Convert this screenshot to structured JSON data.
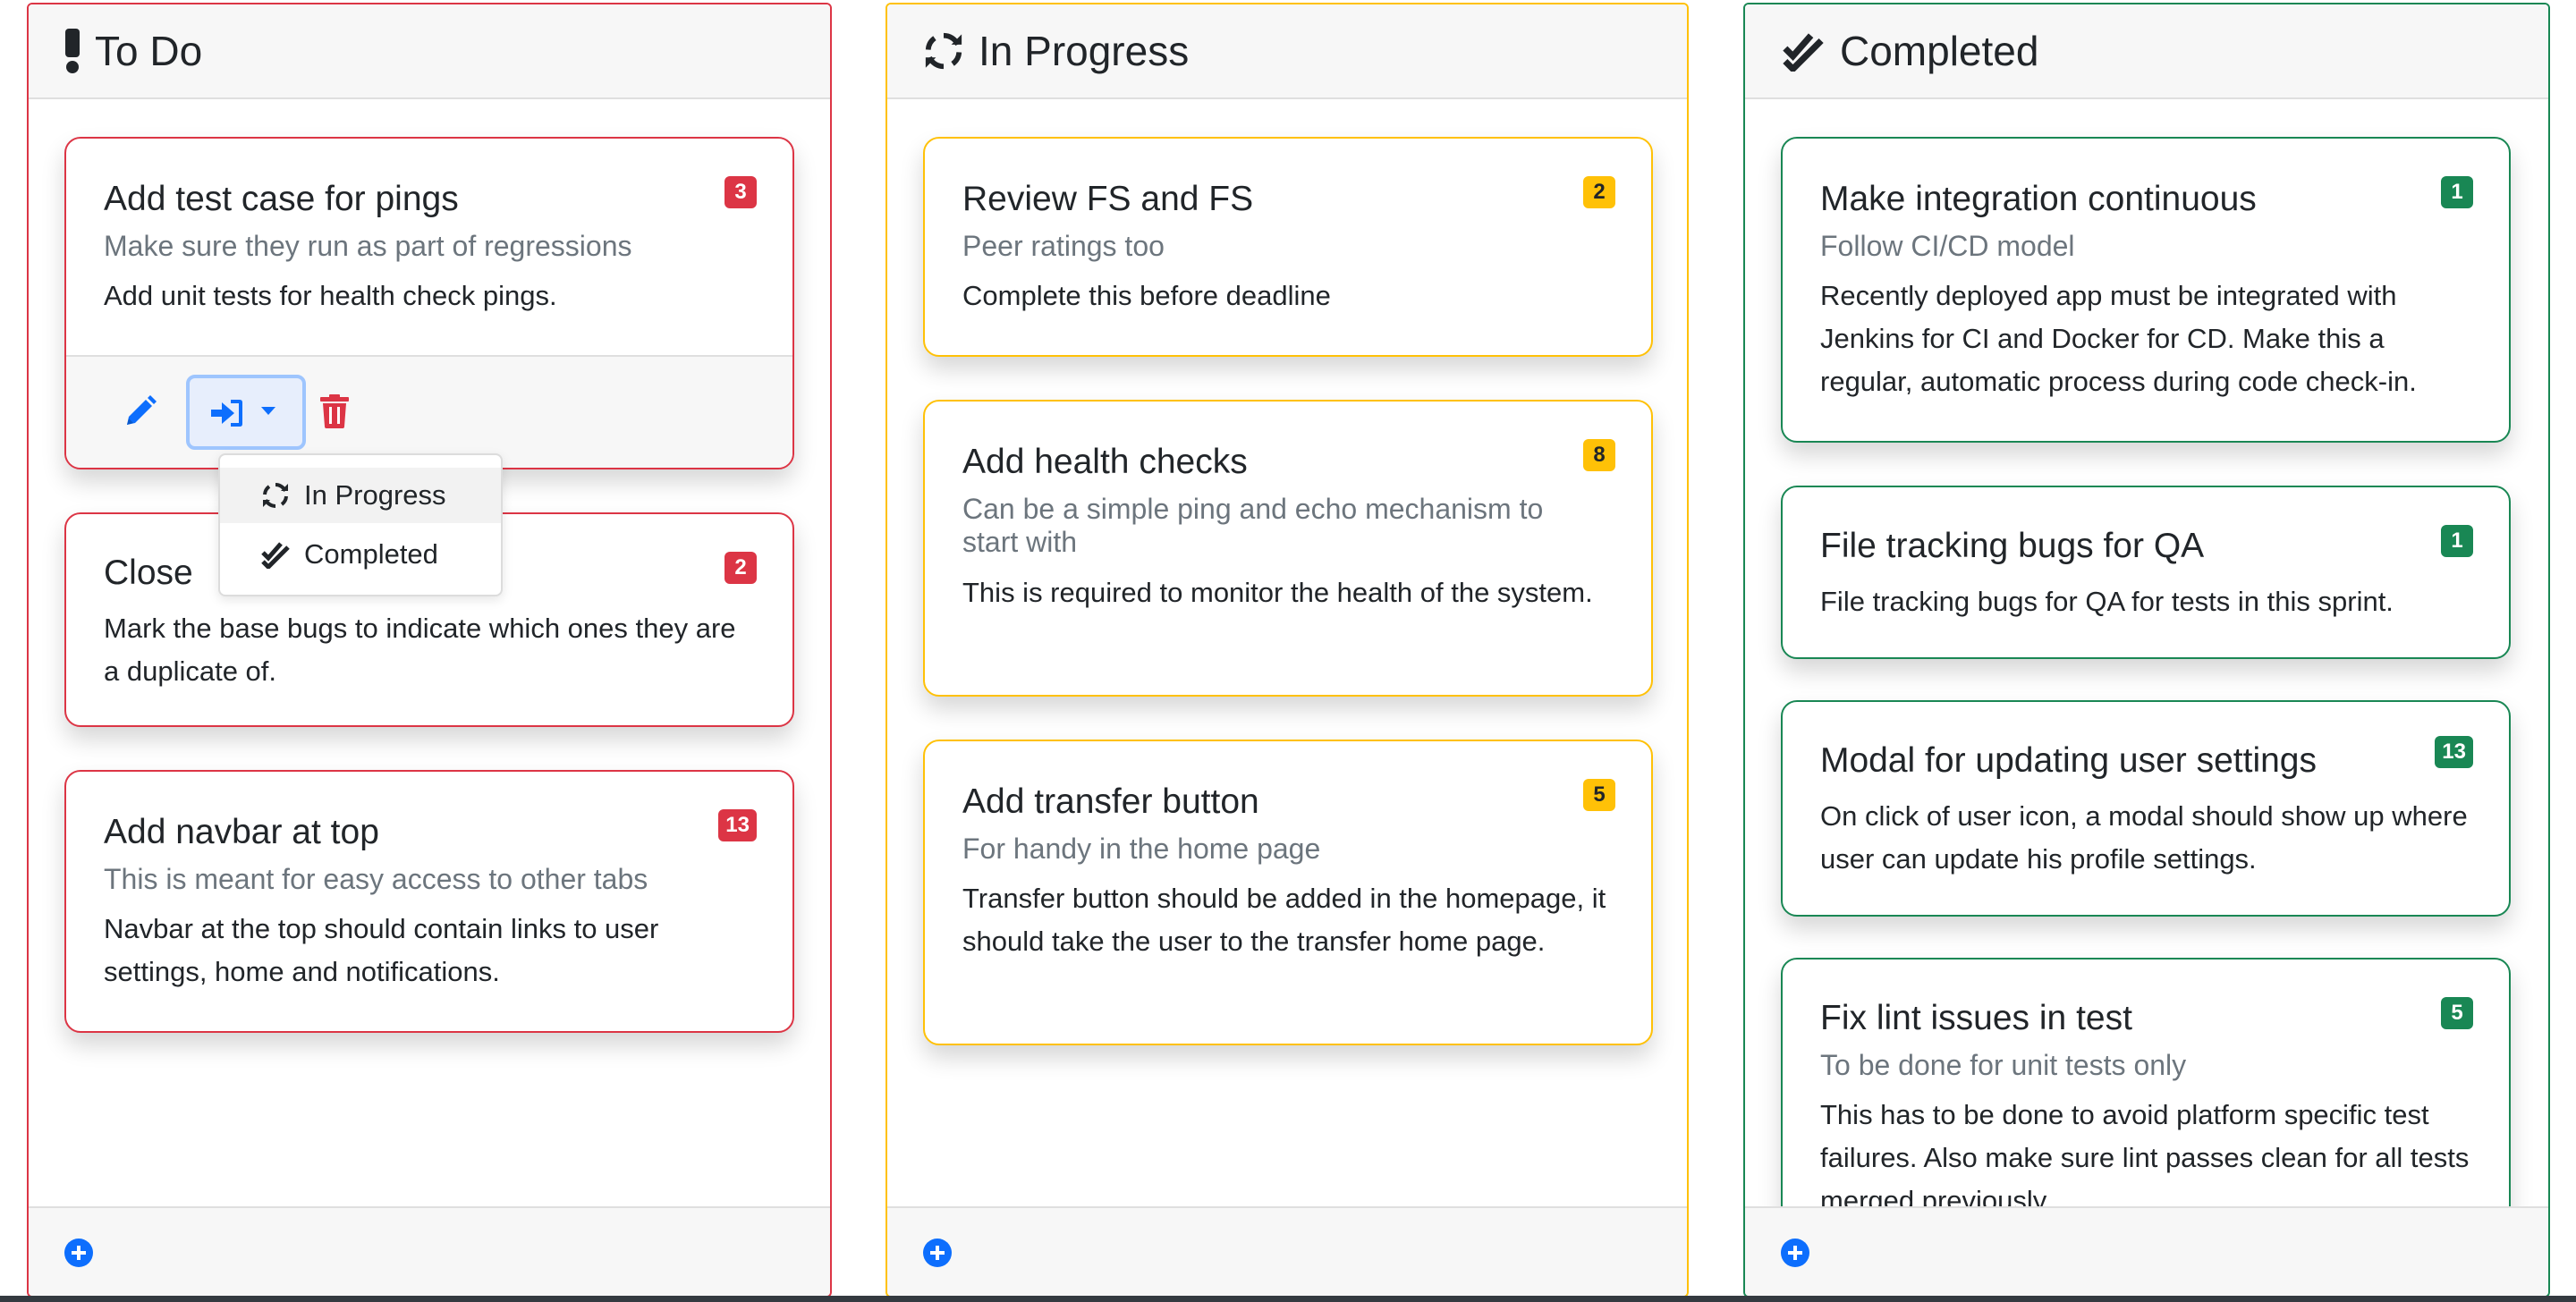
{
  "columns": {
    "todo": {
      "title": "To Do",
      "icon": "exclamation-icon",
      "color": "#dc3545"
    },
    "progress": {
      "title": "In Progress",
      "icon": "sync-icon",
      "color": "#ffc107"
    },
    "done": {
      "title": "Completed",
      "icon": "double-check-icon",
      "color": "#198754"
    }
  },
  "todo_cards": [
    {
      "title": "Add test case for pings",
      "subtitle": "Make sure they run as part of regressions",
      "text": "Add unit tests for health check pings.",
      "badge": "3"
    },
    {
      "title": "Close",
      "subtitle": "",
      "text": "Mark the base bugs to indicate which ones they are a duplicate of.",
      "badge": "2"
    },
    {
      "title": "Add navbar at top",
      "subtitle": "This is meant for easy access to other tabs",
      "text": "Navbar at the top should contain links to user settings, home and notifications.",
      "badge": "13"
    }
  ],
  "progress_cards": [
    {
      "title": "Review FS and FS",
      "subtitle": "Peer ratings too",
      "text": "Complete this before deadline",
      "badge": "2"
    },
    {
      "title": "Add health checks",
      "subtitle": "Can be a simple ping and echo mechanism to start with",
      "text": "This is required to monitor the health of the system.",
      "badge": "8"
    },
    {
      "title": "Add transfer button",
      "subtitle": "For handy in the home page",
      "text": "Transfer button should be added in the homepage, it should take the user to the transfer home page.",
      "badge": "5"
    }
  ],
  "done_cards": [
    {
      "title": "Make integration continuous",
      "subtitle": "Follow CI/CD model",
      "text": "Recently deployed app must be integrated with Jenkins for CI and Docker for CD. Make this a regular, automatic process during code check-in.",
      "badge": "1"
    },
    {
      "title": "File tracking bugs for QA",
      "subtitle": "",
      "text": "File tracking bugs for QA for tests in this sprint.",
      "badge": "1"
    },
    {
      "title": "Modal for updating user settings",
      "subtitle": "",
      "text": "On click of user icon, a modal should show up where user can update his profile settings.",
      "badge": "13"
    },
    {
      "title": "Fix lint issues in test",
      "subtitle": "To be done for unit tests only",
      "text": "This has to be done to avoid platform specific test failures. Also make sure lint passes clean for all tests merged previously.",
      "badge": "5"
    }
  ],
  "dropdown": {
    "items": [
      {
        "label": "In Progress",
        "icon": "sync-icon"
      },
      {
        "label": "Completed",
        "icon": "double-check-icon"
      }
    ]
  },
  "icons": {
    "edit": "pencil-icon",
    "move": "move-to-icon",
    "delete": "trash-icon",
    "add": "plus-circle-icon"
  }
}
